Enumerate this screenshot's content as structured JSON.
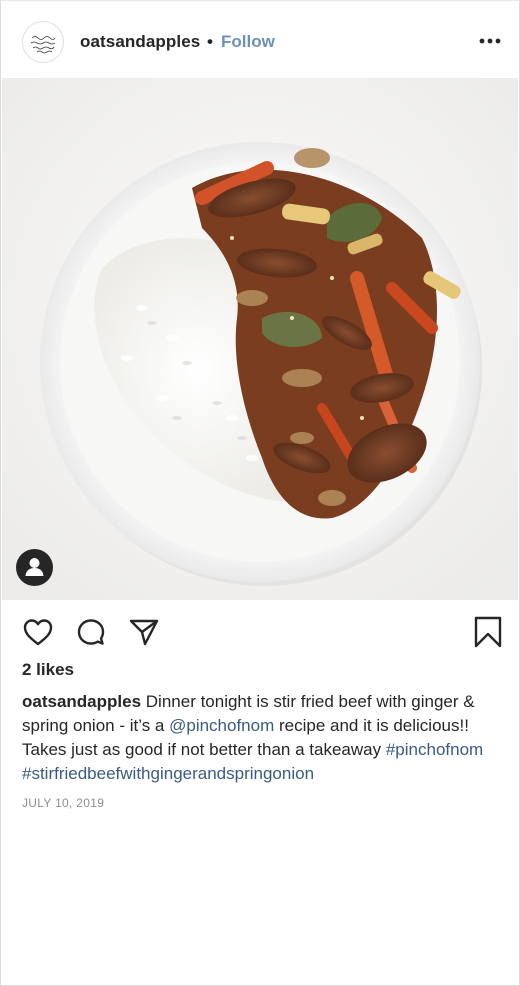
{
  "post": {
    "username": "oatsandapples",
    "separator": "•",
    "follow_label": "Follow",
    "more_icon": "more-horizontal-icon",
    "likes_text": "2 likes",
    "caption": {
      "username": "oatsandapples",
      "text_part1": " Dinner tonight is stir fried beef with ginger & spring onion - it’s a ",
      "mention": "@pinchofnom",
      "text_part2": " recipe and it is delicious!! Takes just as good if not better than a takeaway ",
      "hashtag1": "#pinchofnom",
      "space": " ",
      "hashtag2": "#stirfriedbeefwithgingerandspringonion"
    },
    "date": "JULY 10, 2019"
  },
  "actions": {
    "like_icon": "heart-icon",
    "comment_icon": "comment-icon",
    "share_icon": "share-icon",
    "save_icon": "bookmark-icon"
  },
  "colors": {
    "follow": "#6d8fb8",
    "link": "#3a5a85",
    "text": "#262626",
    "muted": "#8e8e8e"
  }
}
